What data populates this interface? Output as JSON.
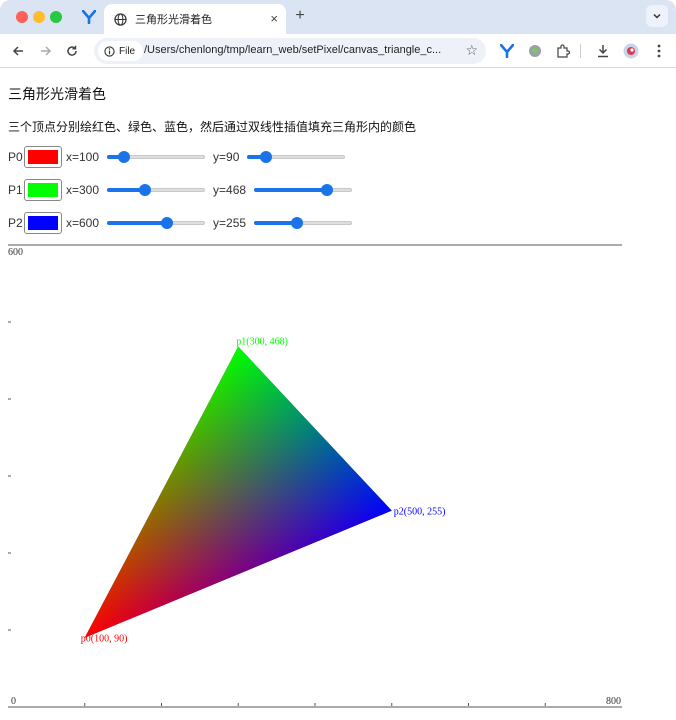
{
  "browser": {
    "tab_title": "三角形光滑着色",
    "info_chip": "File",
    "url": "/Users/chenlong/tmp/learn_web/setPixel/canvas_triangle_c...",
    "tab_close_glyph": "×",
    "new_tab_glyph": "+"
  },
  "page": {
    "title": "三角形光滑着色",
    "description": "三个顶点分别绘红色、绿色、蓝色，然后通过双线性插值填充三角形内的颜色"
  },
  "points": [
    {
      "label": "P0",
      "color": "#ff0000",
      "x_text": "x=100",
      "y_text": "y=90",
      "x": 100,
      "y": 90,
      "coord_label": "p0(100, 90)"
    },
    {
      "label": "P1",
      "color": "#00ff00",
      "x_text": "x=300",
      "y_text": "y=468",
      "x": 300,
      "y": 468,
      "coord_label": "p1(300, 468)"
    },
    {
      "label": "P2",
      "color": "#0000ff",
      "x_text": "x=600",
      "y_text": "y=255",
      "x": 500,
      "y": 255,
      "coord_label": "p2(500, 255)"
    }
  ],
  "sliders": {
    "x_min": 0,
    "x_max": 800,
    "y_min": 0,
    "y_max": 600
  },
  "axes": {
    "x_min_label": "0",
    "x_max_label": "800",
    "y_max_label": "600",
    "x_range": [
      0,
      800
    ],
    "y_range": [
      0,
      600
    ]
  },
  "colors": {
    "accent": "#1a73e8",
    "tabbar": "#dbe4f3"
  },
  "icons": {
    "pinned_tab": "y-logo-icon",
    "tab_favicon": "globe-icon",
    "info": "info-icon",
    "star": "star-icon",
    "extensions": "puzzle-icon",
    "download": "download-icon",
    "menu": "kebab-menu-icon"
  }
}
